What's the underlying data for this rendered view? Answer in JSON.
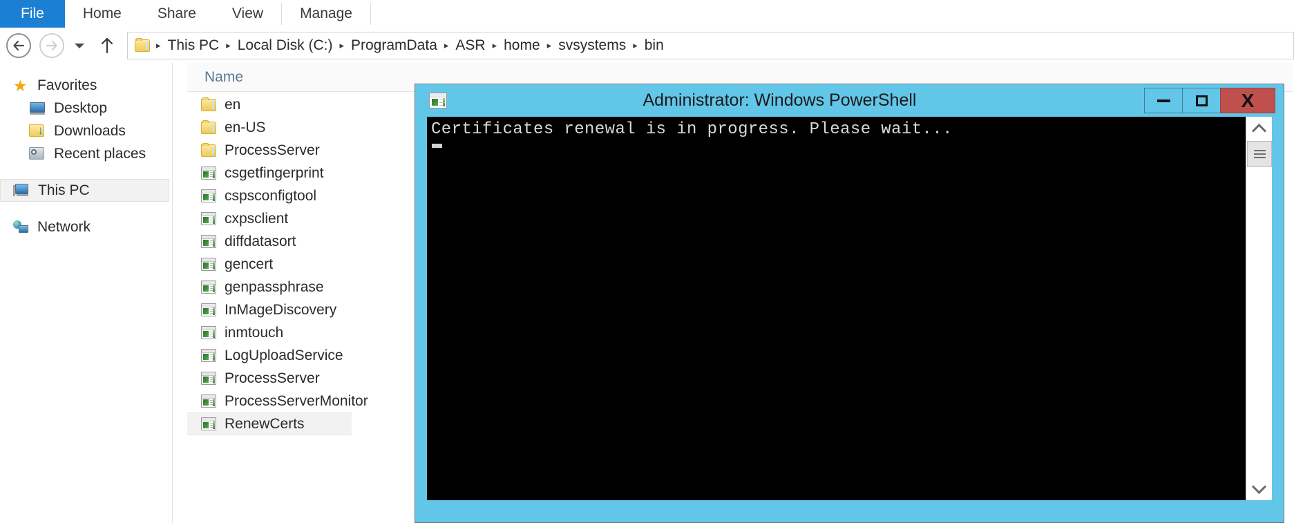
{
  "ribbon": {
    "tabs": [
      {
        "label": "File",
        "active": true
      },
      {
        "label": "Home",
        "active": false
      },
      {
        "label": "Share",
        "active": false
      },
      {
        "label": "View",
        "active": false
      },
      {
        "label": "Manage",
        "active": false
      }
    ],
    "file_tab_bg": "#1b7fd4"
  },
  "addressbar": {
    "back_icon": "back-arrow-icon",
    "forward_icon": "forward-arrow-icon",
    "history_icon": "chevron-down-icon",
    "up_icon": "up-arrow-icon",
    "folder_icon": "folder-icon",
    "breadcrumbs": [
      "This PC",
      "Local Disk (C:)",
      "ProgramData",
      "ASR",
      "home",
      "svsystems",
      "bin"
    ],
    "separator": "▸"
  },
  "navpane": {
    "items": [
      {
        "label": "Favorites",
        "icon": "star-icon",
        "indent": false,
        "selected": false
      },
      {
        "label": "Desktop",
        "icon": "desktop-icon",
        "indent": true,
        "selected": false
      },
      {
        "label": "Downloads",
        "icon": "downloads-folder-icon",
        "indent": true,
        "selected": false
      },
      {
        "label": "Recent places",
        "icon": "recent-places-icon",
        "indent": true,
        "selected": false
      },
      {
        "label": "This PC",
        "icon": "computer-icon",
        "indent": false,
        "selected": true
      },
      {
        "label": "Network",
        "icon": "network-icon",
        "indent": false,
        "selected": false
      }
    ]
  },
  "filelist": {
    "column_header": "Name",
    "rows": [
      {
        "name": "en",
        "type": "folder",
        "selected": false
      },
      {
        "name": "en-US",
        "type": "folder",
        "selected": false
      },
      {
        "name": "ProcessServer",
        "type": "folder",
        "selected": false
      },
      {
        "name": "csgetfingerprint",
        "type": "application",
        "selected": false
      },
      {
        "name": "cspsconfigtool",
        "type": "application",
        "selected": false
      },
      {
        "name": "cxpsclient",
        "type": "application",
        "selected": false
      },
      {
        "name": "diffdatasort",
        "type": "application",
        "selected": false
      },
      {
        "name": "gencert",
        "type": "application",
        "selected": false
      },
      {
        "name": "genpassphrase",
        "type": "application",
        "selected": false
      },
      {
        "name": "InMageDiscovery",
        "type": "application",
        "selected": false
      },
      {
        "name": "inmtouch",
        "type": "application",
        "selected": false
      },
      {
        "name": "LogUploadService",
        "type": "application",
        "selected": false
      },
      {
        "name": "ProcessServer",
        "type": "application",
        "selected": false
      },
      {
        "name": "ProcessServerMonitor",
        "type": "application",
        "selected": false
      },
      {
        "name": "RenewCerts",
        "type": "application",
        "selected": true
      }
    ]
  },
  "powershell": {
    "title": "Administrator: Windows PowerShell",
    "icon": "powershell-console-icon",
    "titlebar_color": "#62c6e8",
    "close_button_color": "#c0504d",
    "console_bg": "#000000",
    "console_text_color": "#d8d8d8",
    "output_lines": [
      "Certificates renewal is in progress. Please wait..."
    ],
    "controls": {
      "minimize": "–",
      "maximize": "□",
      "close": "X"
    },
    "scrollbar": {
      "up_arrow": "scroll-up-icon",
      "down_arrow": "scroll-down-icon",
      "thumb": "scrollbar-thumb"
    }
  }
}
